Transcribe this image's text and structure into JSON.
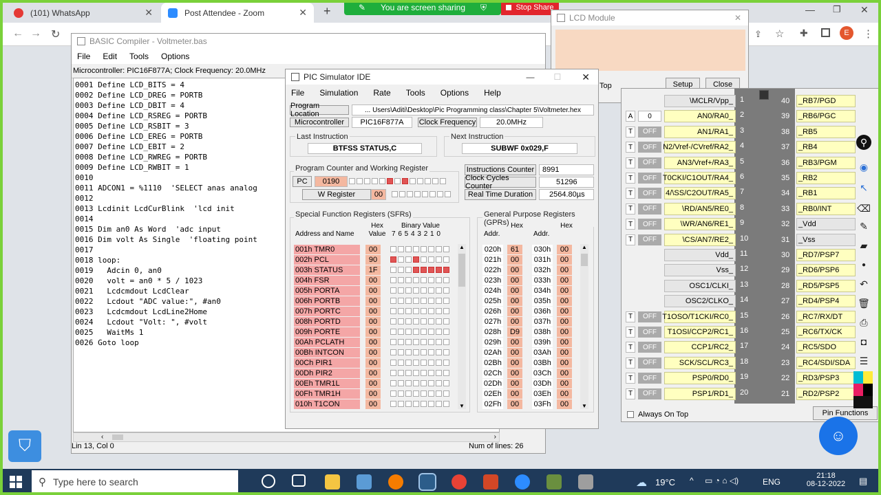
{
  "browser": {
    "tabs": [
      {
        "label": "(101) WhatsApp"
      },
      {
        "label": "Post Attendee - Zoom"
      }
    ],
    "new_tab": "+"
  },
  "share": {
    "status": "You are screen sharing",
    "stop": "Stop Share"
  },
  "lcd": {
    "title": "LCD Module",
    "setup": "Setup",
    "close": "Close",
    "top": "Top"
  },
  "compiler": {
    "title": "BASIC Compiler - Voltmeter.bas",
    "menu": [
      "File",
      "Edit",
      "Tools",
      "Options"
    ],
    "status": "Microcontroller: PIC16F877A; Clock Frequency: 20.0MHz",
    "code": "0001 Define LCD_BITS = 4\n0002 Define LCD_DREG = PORTB\n0003 Define LCD_DBIT = 4\n0004 Define LCD_RSREG = PORTB\n0005 Define LCD_RSBIT = 3\n0006 Define LCD_EREG = PORTB\n0007 Define LCD_EBIT = 2\n0008 Define LCD_RWREG = PORTB\n0009 Define LCD_RWBIT = 1\n0010\n0011 ADCON1 = %1110  'SELECT anas analog\n0012\n0013 Lcdinit LcdCurBlink  'lcd init\n0014\n0015 Dim an0 As Word  'adc input\n0016 Dim volt As Single  'floating point\n0017\n0018 loop:\n0019   Adcin 0, an0\n0020   volt = an0 * 5 / 1023\n0021   Lcdcmdout LcdClear\n0022   Lcdout \"ADC value:\", #an0\n0023   Lcdcmdout LcdLine2Home\n0024   Lcdout \"Volt: \", #volt\n0025   WaitMs 1\n0026 Goto loop",
    "pos": "Lin 13, Col 0",
    "lines": "Num of lines: 26"
  },
  "ide": {
    "title": "PIC Simulator IDE",
    "menu": [
      "File",
      "Simulation",
      "Rate",
      "Tools",
      "Options",
      "Help"
    ],
    "prog_loc_label": "Program Location",
    "prog_loc": "... Users\\Aditi\\Desktop\\Pic Programming class\\Chapter 5\\Voltmeter.hex",
    "mcu_label": "Microcontroller",
    "mcu": "PIC16F877A",
    "clk_label": "Clock Frequency",
    "clk": "20.0MHz",
    "last_label": "Last Instruction",
    "last": "BTFSS STATUS,C",
    "next_label": "Next Instruction",
    "next": "SUBWF 0x029,F",
    "pcw_label": "Program Counter and Working Register",
    "pc_label": "PC",
    "pc": "0190",
    "w_label": "W Register",
    "w": "00",
    "ic_label": "Instructions Counter",
    "ic": "8991",
    "cc_label": "Clock Cycles Counter",
    "cc": "51296",
    "rt_label": "Real Time Duration",
    "rt": "2564.80µs",
    "sfr_label": "Special Function Registers (SFRs)",
    "addr_name": "Address and Name",
    "hexval": "Hex Value",
    "binval": "Binary Value",
    "bitnums": "7 6 5 4 3 2 1 0",
    "gpr_label": "General Purpose Registers (GPRs)",
    "addr": "Addr.",
    "hex": "Hex",
    "sfrs": [
      {
        "n": "001h  TMR0",
        "v": "00"
      },
      {
        "n": "002h  PCL",
        "v": "90"
      },
      {
        "n": "003h  STATUS",
        "v": "1F"
      },
      {
        "n": "004h  FSR",
        "v": "00"
      },
      {
        "n": "005h  PORTA",
        "v": "00"
      },
      {
        "n": "006h  PORTB",
        "v": "00"
      },
      {
        "n": "007h  PORTC",
        "v": "00"
      },
      {
        "n": "008h  PORTD",
        "v": "00"
      },
      {
        "n": "009h  PORTE",
        "v": "00"
      },
      {
        "n": "00Ah  PCLATH",
        "v": "00"
      },
      {
        "n": "00Bh  INTCON",
        "v": "00"
      },
      {
        "n": "00Ch  PIR1",
        "v": "00"
      },
      {
        "n": "00Dh  PIR2",
        "v": "00"
      },
      {
        "n": "00Eh  TMR1L",
        "v": "00"
      },
      {
        "n": "00Fh  TMR1H",
        "v": "00"
      },
      {
        "n": "010h  T1CON",
        "v": "00"
      }
    ],
    "gprs": [
      {
        "a1": "020h",
        "v1": "61",
        "a2": "030h",
        "v2": "00"
      },
      {
        "a1": "021h",
        "v1": "00",
        "a2": "031h",
        "v2": "00"
      },
      {
        "a1": "022h",
        "v1": "00",
        "a2": "032h",
        "v2": "00"
      },
      {
        "a1": "023h",
        "v1": "00",
        "a2": "033h",
        "v2": "00"
      },
      {
        "a1": "024h",
        "v1": "00",
        "a2": "034h",
        "v2": "00"
      },
      {
        "a1": "025h",
        "v1": "00",
        "a2": "035h",
        "v2": "00"
      },
      {
        "a1": "026h",
        "v1": "00",
        "a2": "036h",
        "v2": "00"
      },
      {
        "a1": "027h",
        "v1": "00",
        "a2": "037h",
        "v2": "00"
      },
      {
        "a1": "028h",
        "v1": "D9",
        "a2": "038h",
        "v2": "00"
      },
      {
        "a1": "029h",
        "v1": "00",
        "a2": "039h",
        "v2": "00"
      },
      {
        "a1": "02Ah",
        "v1": "00",
        "a2": "03Ah",
        "v2": "00"
      },
      {
        "a1": "02Bh",
        "v1": "00",
        "a2": "03Bh",
        "v2": "00"
      },
      {
        "a1": "02Ch",
        "v1": "00",
        "a2": "03Ch",
        "v2": "00"
      },
      {
        "a1": "02Dh",
        "v1": "00",
        "a2": "03Dh",
        "v2": "00"
      },
      {
        "a1": "02Eh",
        "v1": "00",
        "a2": "03Eh",
        "v2": "00"
      },
      {
        "a1": "02Fh",
        "v1": "00",
        "a2": "03Fh",
        "v2": "00"
      }
    ]
  },
  "pins": {
    "left": [
      {
        "t": "",
        "s": "",
        "n": "\\MCLR/Vpp_",
        "num": "1"
      },
      {
        "t": "A",
        "s": "0",
        "n": "AN0/RA0_",
        "num": "2"
      },
      {
        "t": "T",
        "s": "OFF",
        "n": "AN1/RA1_",
        "num": "3"
      },
      {
        "t": "T",
        "s": "OFF",
        "n": "N2/Vref-/CVref/RA2_",
        "num": "4"
      },
      {
        "t": "T",
        "s": "OFF",
        "n": "AN3/Vref+/RA3_",
        "num": "5"
      },
      {
        "t": "T",
        "s": "OFF",
        "n": "T0CKI/C1OUT/RA4_",
        "num": "6"
      },
      {
        "t": "T",
        "s": "OFF",
        "n": "4/\\SS/C2OUT/RA5_",
        "num": "7"
      },
      {
        "t": "T",
        "s": "OFF",
        "n": "\\RD/AN5/RE0_",
        "num": "8"
      },
      {
        "t": "T",
        "s": "OFF",
        "n": "\\WR/AN6/RE1_",
        "num": "9"
      },
      {
        "t": "T",
        "s": "OFF",
        "n": "\\CS/AN7/RE2_",
        "num": "10"
      },
      {
        "t": "",
        "s": "",
        "n": "Vdd_",
        "num": "11"
      },
      {
        "t": "",
        "s": "",
        "n": "Vss_",
        "num": "12"
      },
      {
        "t": "",
        "s": "",
        "n": "OSC1/CLKI_",
        "num": "13"
      },
      {
        "t": "",
        "s": "",
        "n": "OSC2/CLKO_",
        "num": "14"
      },
      {
        "t": "T",
        "s": "OFF",
        "n": "T1OSO/T1CKI/RC0_",
        "num": "15"
      },
      {
        "t": "T",
        "s": "OFF",
        "n": "T1OSI/CCP2/RC1_",
        "num": "16"
      },
      {
        "t": "T",
        "s": "OFF",
        "n": "CCP1/RC2_",
        "num": "17"
      },
      {
        "t": "T",
        "s": "OFF",
        "n": "SCK/SCL/RC3_",
        "num": "18"
      },
      {
        "t": "T",
        "s": "OFF",
        "n": "PSP0/RD0_",
        "num": "19"
      },
      {
        "t": "T",
        "s": "OFF",
        "n": "PSP1/RD1_",
        "num": "20"
      }
    ],
    "right": [
      {
        "num": "40",
        "n": "_RB7/PGD"
      },
      {
        "num": "39",
        "n": "_RB6/PGC"
      },
      {
        "num": "38",
        "n": "_RB5"
      },
      {
        "num": "37",
        "n": "_RB4"
      },
      {
        "num": "36",
        "n": "_RB3/PGM"
      },
      {
        "num": "35",
        "n": "_RB2"
      },
      {
        "num": "34",
        "n": "_RB1"
      },
      {
        "num": "33",
        "n": "_RB0/INT"
      },
      {
        "num": "32",
        "n": "_Vdd"
      },
      {
        "num": "31",
        "n": "_Vss"
      },
      {
        "num": "30",
        "n": "_RD7/PSP7"
      },
      {
        "num": "29",
        "n": "_RD6/PSP6"
      },
      {
        "num": "28",
        "n": "_RD5/PSP5"
      },
      {
        "num": "27",
        "n": "_RD4/PSP4"
      },
      {
        "num": "26",
        "n": "_RC7/RX/DT"
      },
      {
        "num": "25",
        "n": "_RC6/TX/CK"
      },
      {
        "num": "24",
        "n": "_RC5/SDO"
      },
      {
        "num": "23",
        "n": "_RC4/SDI/SDA"
      },
      {
        "num": "22",
        "n": "_RD3/PSP3"
      },
      {
        "num": "21",
        "n": "_RD2/PSP2"
      }
    ],
    "always_on_top": "Always On Top",
    "pin_functions": "Pin Functions"
  },
  "taskbar": {
    "search": "Type here to search",
    "weather": "19°C",
    "lang": "ENG",
    "time": "21:18",
    "date": "08-12-2022"
  },
  "colors": {
    "share": "#1fae3c",
    "stop": "#e2262d",
    "sfr": "#f4a6a6",
    "pin": "#ffffc0",
    "chip": "#7b7b7b"
  }
}
